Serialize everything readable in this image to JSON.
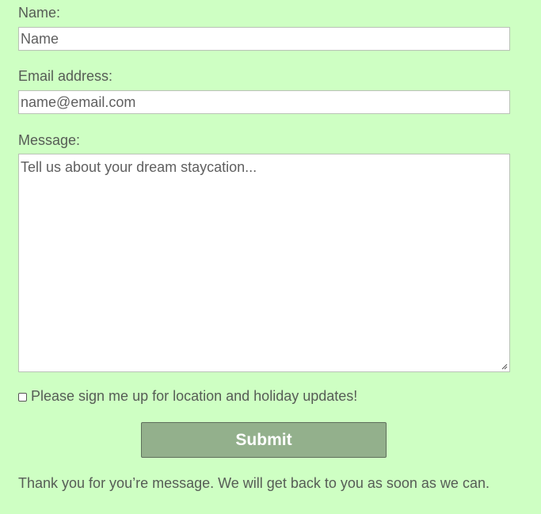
{
  "form": {
    "name_label": "Name:",
    "name_value": "Name",
    "email_label": "Email address:",
    "email_value": "name@email.com",
    "message_label": "Message:",
    "message_value": "Tell us about your dream staycation...",
    "signup_label": "Please sign me up for location and holiday updates!",
    "signup_checked": false,
    "submit_label": "Submit",
    "thanks_message": "Thank you for you’re message. We will get back to you as soon as we can."
  }
}
